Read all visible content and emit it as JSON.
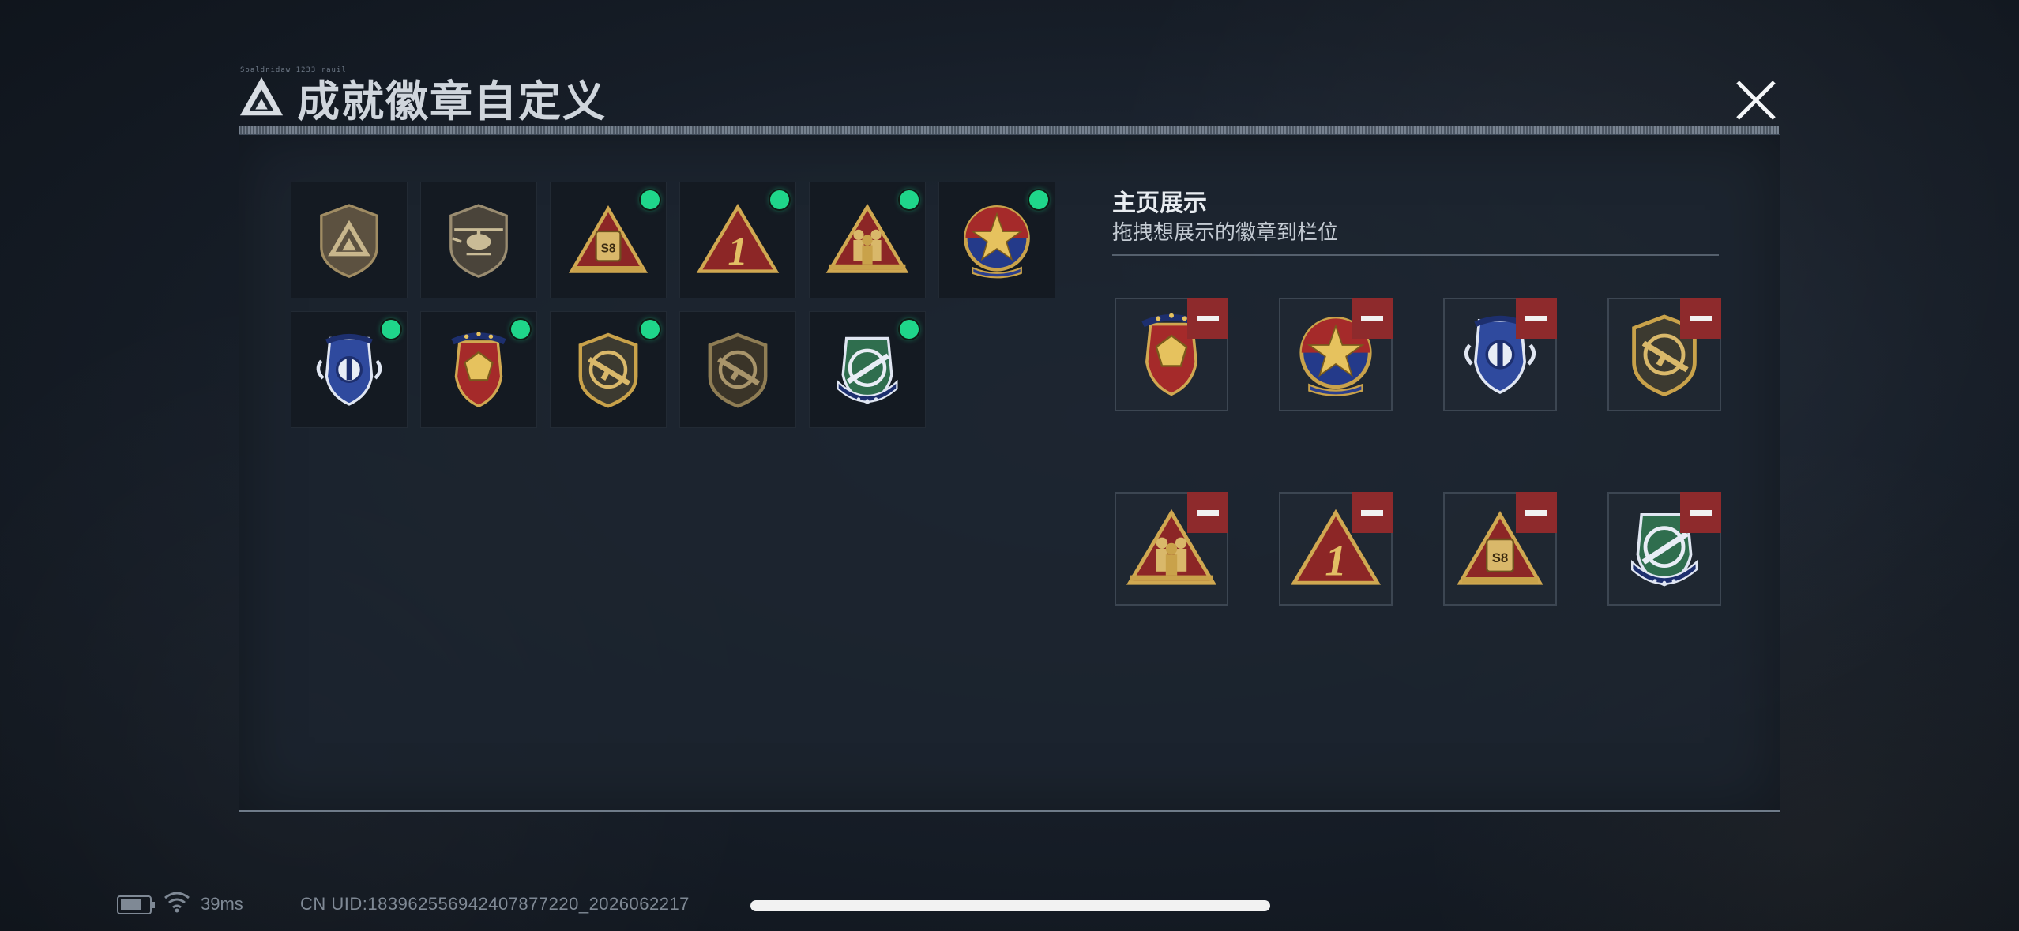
{
  "header": {
    "title": "成就徽章自定义",
    "tiny_text": "Soaldnidaw 1233  rauil",
    "close_icon": "close-icon"
  },
  "colors": {
    "active_dot": "#1fd68a",
    "remove_button": "#8e2a2c",
    "panel_bg": "#1c242f",
    "gold": "#c9a24a",
    "red": "#8c2626"
  },
  "badge_grid": {
    "badges": [
      {
        "icon": "bronze-shield-triangle-badge-icon",
        "equipped": false
      },
      {
        "icon": "helicopter-shield-badge-icon",
        "equipped": false
      },
      {
        "icon": "s8-triangle-badge-icon",
        "equipped": true
      },
      {
        "icon": "number-one-triangle-badge-icon",
        "equipped": true
      },
      {
        "icon": "soldiers-triangle-badge-icon",
        "equipped": true
      },
      {
        "icon": "star-circle-badge-icon",
        "equipped": true
      },
      {
        "icon": "blue-winged-shield-badge-icon",
        "equipped": true
      },
      {
        "icon": "red-gem-shield-badge-icon",
        "equipped": true
      },
      {
        "icon": "rifle-shield-badge-icon",
        "equipped": true
      },
      {
        "icon": "rifle-shield-dark-badge-icon",
        "equipped": false
      },
      {
        "icon": "green-crosshair-badge-icon",
        "equipped": true
      }
    ]
  },
  "showcase": {
    "title": "主页展示",
    "subtitle": "拖拽想展示的徽章到栏位",
    "slots": [
      {
        "icon": "red-gem-shield-badge-icon"
      },
      {
        "icon": "star-circle-badge-icon"
      },
      {
        "icon": "blue-winged-shield-badge-icon"
      },
      {
        "icon": "rifle-shield-badge-icon"
      },
      {
        "icon": "soldiers-triangle-badge-icon"
      },
      {
        "icon": "number-one-triangle-badge-icon"
      },
      {
        "icon": "s8-triangle-badge-icon"
      },
      {
        "icon": "green-crosshair-badge-icon"
      }
    ]
  },
  "status_bar": {
    "ping": "39ms",
    "uid": "CN UID:183962556942407877220_2026062217"
  }
}
